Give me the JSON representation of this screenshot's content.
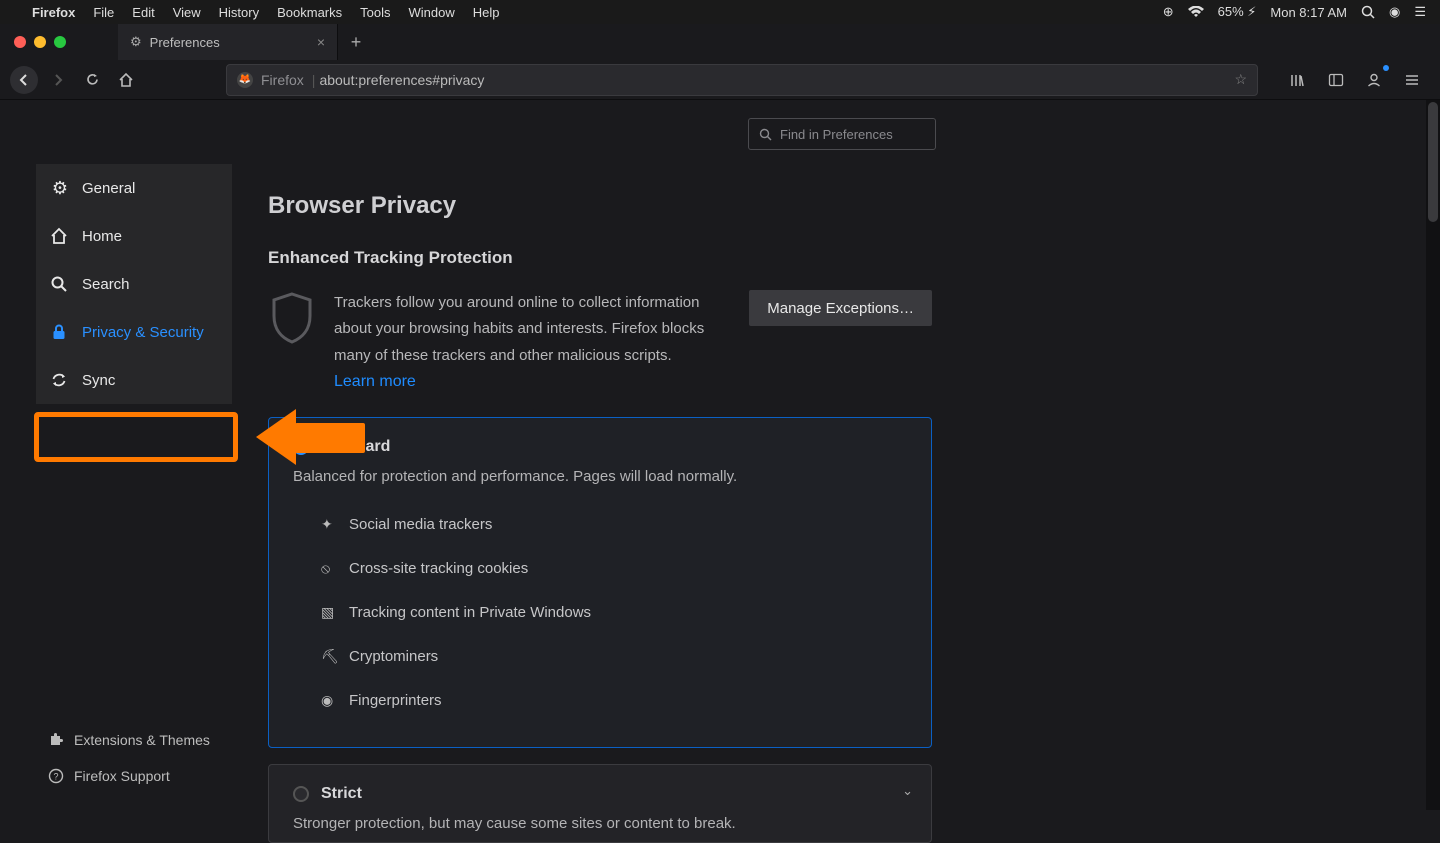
{
  "menubar": {
    "app": "Firefox",
    "items": [
      "File",
      "Edit",
      "View",
      "History",
      "Bookmarks",
      "Tools",
      "Window",
      "Help"
    ],
    "battery_pct": "65%",
    "clock": "Mon 8:17 AM"
  },
  "tab": {
    "title": "Preferences"
  },
  "urlbar": {
    "identity": "Firefox",
    "url": "about:preferences#privacy"
  },
  "search": {
    "placeholder": "Find in Preferences"
  },
  "sidebar": {
    "items": [
      {
        "label": "General"
      },
      {
        "label": "Home"
      },
      {
        "label": "Search"
      },
      {
        "label": "Privacy & Security"
      },
      {
        "label": "Sync"
      }
    ],
    "footer": [
      {
        "label": "Extensions & Themes"
      },
      {
        "label": "Firefox Support"
      }
    ]
  },
  "page": {
    "title": "Browser Privacy",
    "section": "Enhanced Tracking Protection",
    "blurb": "Trackers follow you around online to collect information about your browsing habits and interests. Firefox blocks many of these trackers and other malicious scripts.",
    "learn": "Learn more",
    "manage_btn": "Manage Exceptions…",
    "standard": {
      "title": "Standard",
      "desc": "Balanced for protection and performance. Pages will load normally.",
      "features": [
        "Social media trackers",
        "Cross-site tracking cookies",
        "Tracking content in Private Windows",
        "Cryptominers",
        "Fingerprinters"
      ]
    },
    "strict": {
      "title": "Strict",
      "desc": "Stronger protection, but may cause some sites or content to break."
    }
  }
}
